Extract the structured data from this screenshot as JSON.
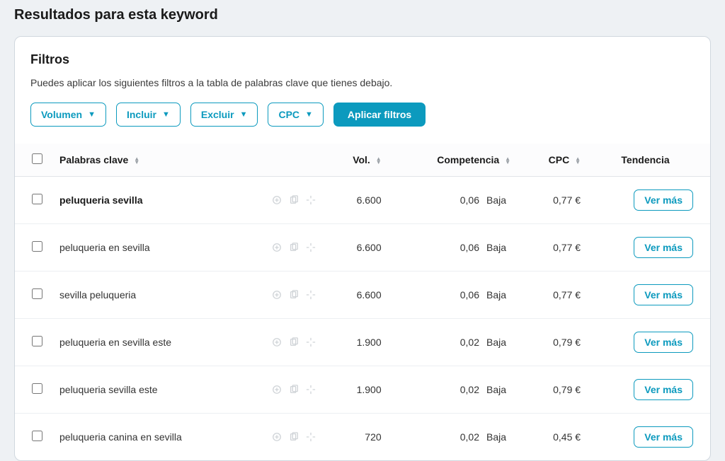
{
  "page": {
    "title": "Resultados para esta keyword"
  },
  "filters": {
    "heading": "Filtros",
    "description": "Puedes aplicar los siguientes filtros a la tabla de palabras clave que tienes debajo.",
    "buttons": {
      "volumen": "Volumen",
      "incluir": "Incluir",
      "excluir": "Excluir",
      "cpc": "CPC"
    },
    "apply": "Aplicar filtros"
  },
  "table": {
    "headers": {
      "keyword": "Palabras clave",
      "vol": "Vol.",
      "competencia": "Competencia",
      "cpc": "CPC",
      "tendencia": "Tendencia"
    },
    "ver_mas": "Ver más",
    "rows": [
      {
        "keyword": "peluqueria sevilla",
        "bold": true,
        "vol": "6.600",
        "comp_val": "0,06",
        "comp_label": "Baja",
        "cpc": "0,77 €"
      },
      {
        "keyword": "peluqueria en sevilla",
        "bold": false,
        "vol": "6.600",
        "comp_val": "0,06",
        "comp_label": "Baja",
        "cpc": "0,77 €"
      },
      {
        "keyword": "sevilla peluqueria",
        "bold": false,
        "vol": "6.600",
        "comp_val": "0,06",
        "comp_label": "Baja",
        "cpc": "0,77 €"
      },
      {
        "keyword": "peluqueria en sevilla este",
        "bold": false,
        "vol": "1.900",
        "comp_val": "0,02",
        "comp_label": "Baja",
        "cpc": "0,79 €"
      },
      {
        "keyword": "peluqueria sevilla este",
        "bold": false,
        "vol": "1.900",
        "comp_val": "0,02",
        "comp_label": "Baja",
        "cpc": "0,79 €"
      },
      {
        "keyword": "peluqueria canina en sevilla",
        "bold": false,
        "vol": "720",
        "comp_val": "0,02",
        "comp_label": "Baja",
        "cpc": "0,45 €"
      }
    ]
  }
}
